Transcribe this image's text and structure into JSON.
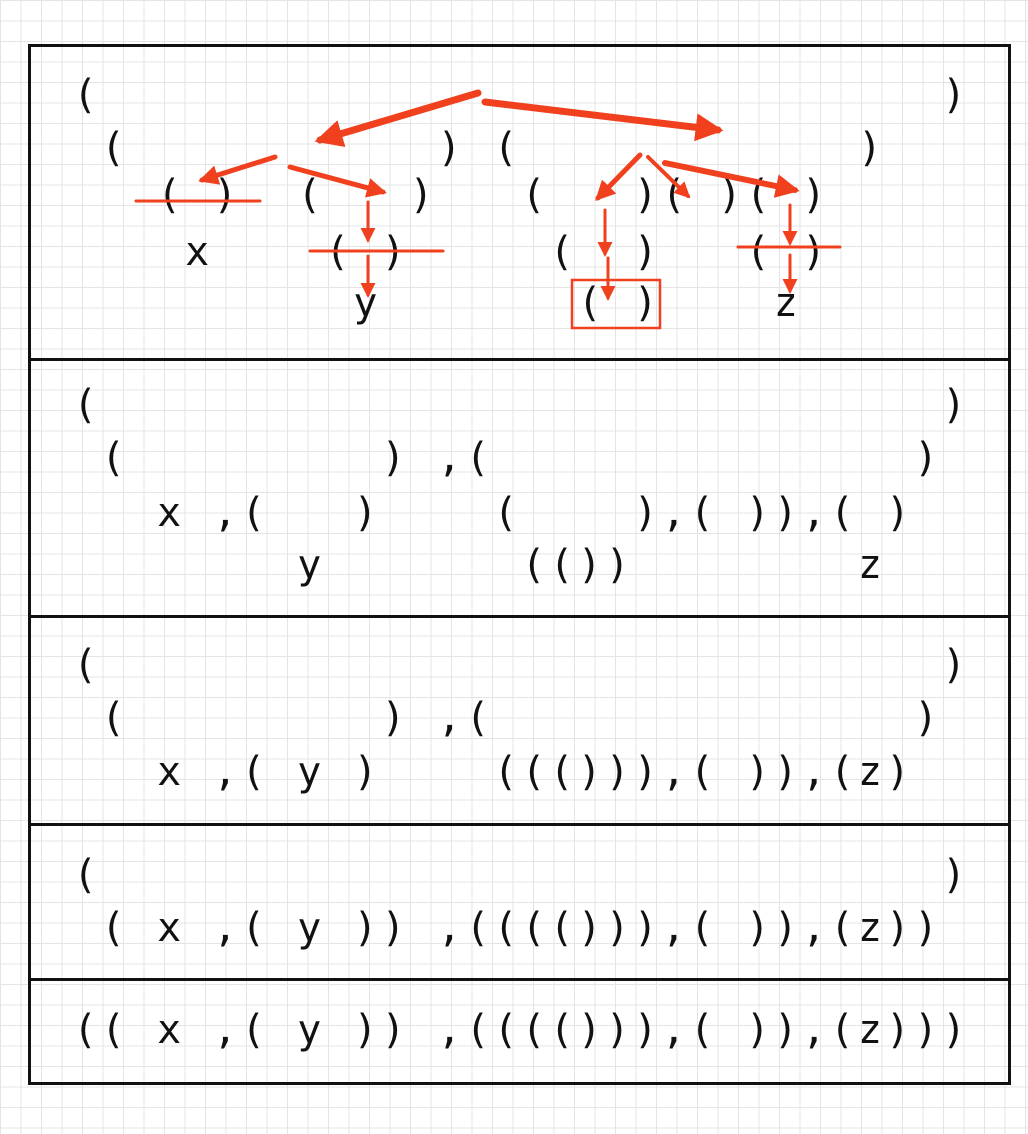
{
  "panels": [
    {
      "lines": [
        "(                              )",
        " (           ) (            )",
        "   ( )  (   )   (   )( )( )",
        "    x    ( )     (  )   ( )",
        "          y       ( )    z"
      ]
    },
    {
      "lines": [
        "(                              )",
        " (         ) ,(               )",
        "   x ,(   )    (    ),( )),( )",
        "        y       (())        z"
      ]
    },
    {
      "lines": [
        "(                              )",
        " (         ) ,(               )",
        "   x ,( y )    ((())),( )),(z)"
      ]
    },
    {
      "lines": [
        "(                              )",
        " ( x ,( y )) ,(((())),( )),(z))"
      ]
    },
    {
      "lines": [
        "(( x ,( y )) ,(((())),( )),(z)))"
      ]
    }
  ],
  "colors": {
    "arrow": "#f0401e",
    "border": "#111111",
    "grid": "#e4e4e4"
  }
}
